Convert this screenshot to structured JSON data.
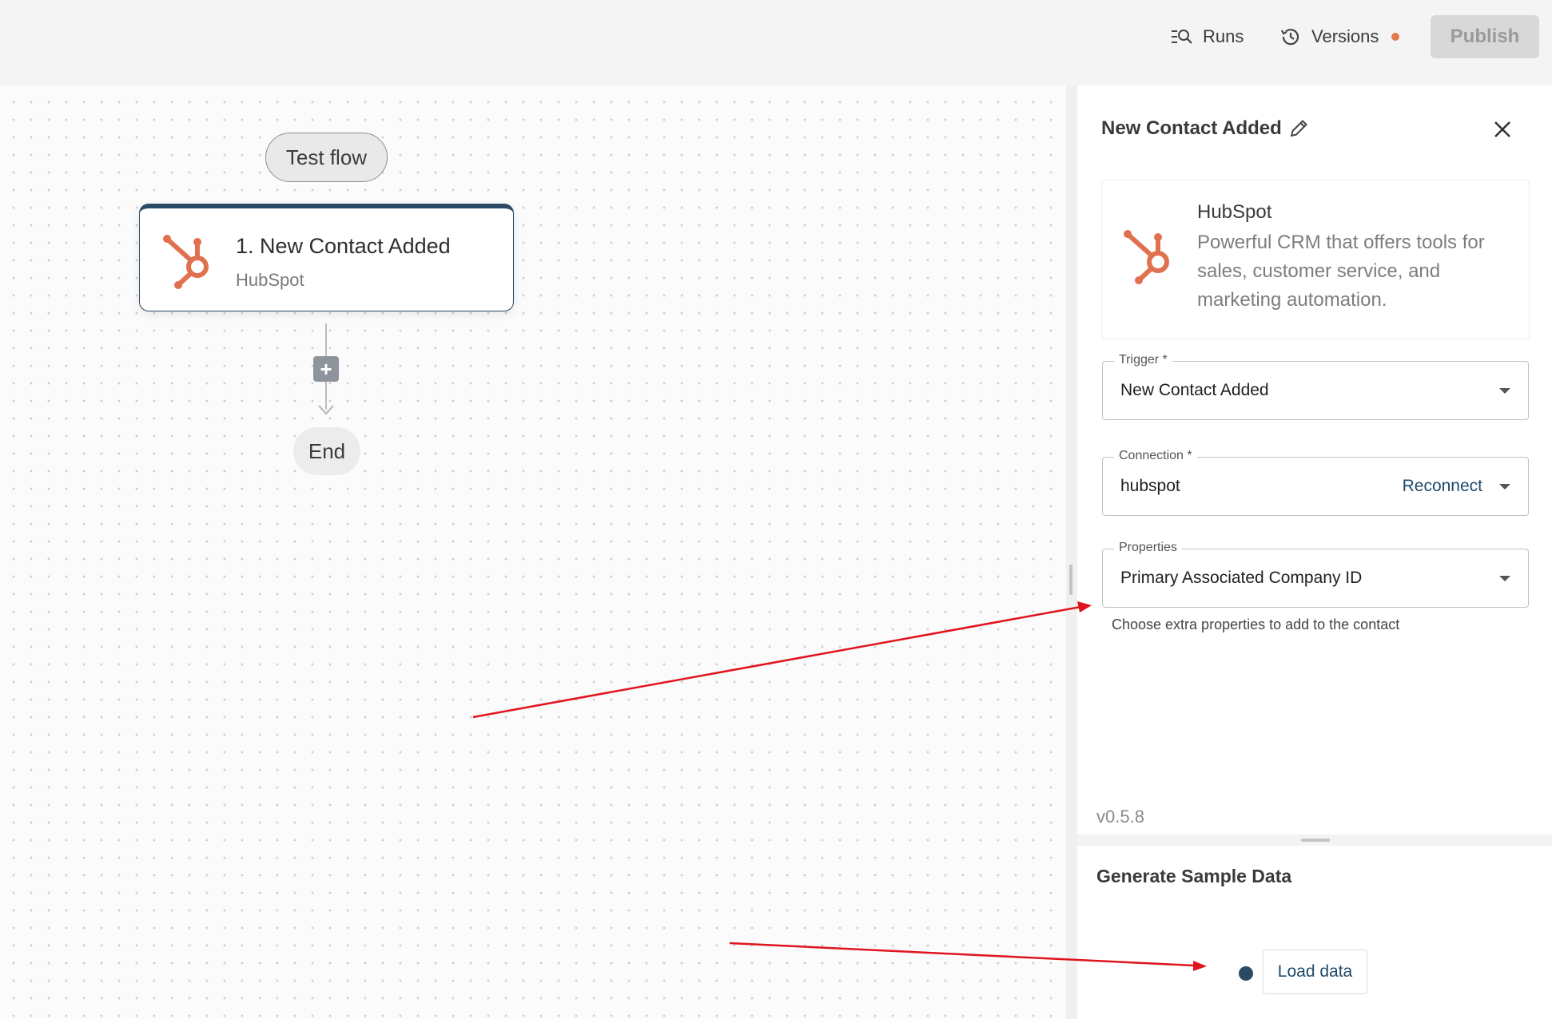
{
  "header": {
    "runs_label": "Runs",
    "versions_label": "Versions",
    "publish_label": "Publish"
  },
  "canvas": {
    "test_flow_label": "Test flow",
    "node": {
      "title": "1. New Contact Added",
      "subtitle": "HubSpot",
      "icon": "hubspot-icon"
    },
    "add_step_symbol": "+",
    "end_label": "End"
  },
  "panel": {
    "title": "New Contact Added",
    "app": {
      "name": "HubSpot",
      "description": "Powerful CRM that offers tools for sales, customer service, and marketing automation."
    },
    "trigger": {
      "label": "Trigger",
      "required": "*",
      "value": "New Contact Added"
    },
    "connection": {
      "label": "Connection",
      "required": "*",
      "value": "hubspot",
      "action": "Reconnect"
    },
    "properties": {
      "label": "Properties",
      "value": "Primary Associated Company ID",
      "helper": "Choose extra properties to add to the contact"
    },
    "version": "v0.5.8"
  },
  "sample_data": {
    "title": "Generate Sample Data",
    "load_label": "Load data"
  },
  "colors": {
    "brand_hubspot": "#e0714f",
    "node_border": "#2c4a63",
    "annotation_arrow": "#e0141e",
    "versions_dot": "#e07a4a"
  }
}
